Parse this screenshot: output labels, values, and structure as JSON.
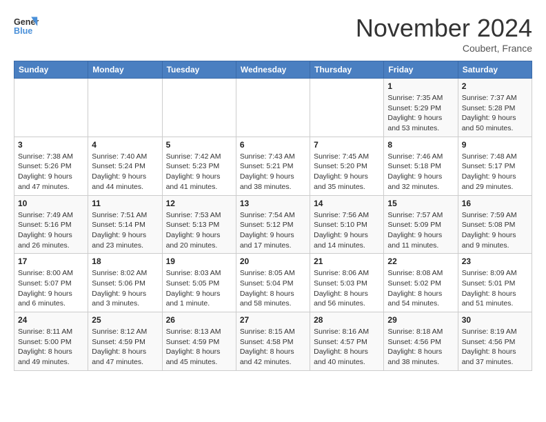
{
  "logo": {
    "line1": "General",
    "line2": "Blue"
  },
  "header": {
    "month": "November 2024",
    "location": "Coubert, France"
  },
  "weekdays": [
    "Sunday",
    "Monday",
    "Tuesday",
    "Wednesday",
    "Thursday",
    "Friday",
    "Saturday"
  ],
  "weeks": [
    [
      {
        "day": "",
        "info": ""
      },
      {
        "day": "",
        "info": ""
      },
      {
        "day": "",
        "info": ""
      },
      {
        "day": "",
        "info": ""
      },
      {
        "day": "",
        "info": ""
      },
      {
        "day": "1",
        "info": "Sunrise: 7:35 AM\nSunset: 5:29 PM\nDaylight: 9 hours\nand 53 minutes."
      },
      {
        "day": "2",
        "info": "Sunrise: 7:37 AM\nSunset: 5:28 PM\nDaylight: 9 hours\nand 50 minutes."
      }
    ],
    [
      {
        "day": "3",
        "info": "Sunrise: 7:38 AM\nSunset: 5:26 PM\nDaylight: 9 hours\nand 47 minutes."
      },
      {
        "day": "4",
        "info": "Sunrise: 7:40 AM\nSunset: 5:24 PM\nDaylight: 9 hours\nand 44 minutes."
      },
      {
        "day": "5",
        "info": "Sunrise: 7:42 AM\nSunset: 5:23 PM\nDaylight: 9 hours\nand 41 minutes."
      },
      {
        "day": "6",
        "info": "Sunrise: 7:43 AM\nSunset: 5:21 PM\nDaylight: 9 hours\nand 38 minutes."
      },
      {
        "day": "7",
        "info": "Sunrise: 7:45 AM\nSunset: 5:20 PM\nDaylight: 9 hours\nand 35 minutes."
      },
      {
        "day": "8",
        "info": "Sunrise: 7:46 AM\nSunset: 5:18 PM\nDaylight: 9 hours\nand 32 minutes."
      },
      {
        "day": "9",
        "info": "Sunrise: 7:48 AM\nSunset: 5:17 PM\nDaylight: 9 hours\nand 29 minutes."
      }
    ],
    [
      {
        "day": "10",
        "info": "Sunrise: 7:49 AM\nSunset: 5:16 PM\nDaylight: 9 hours\nand 26 minutes."
      },
      {
        "day": "11",
        "info": "Sunrise: 7:51 AM\nSunset: 5:14 PM\nDaylight: 9 hours\nand 23 minutes."
      },
      {
        "day": "12",
        "info": "Sunrise: 7:53 AM\nSunset: 5:13 PM\nDaylight: 9 hours\nand 20 minutes."
      },
      {
        "day": "13",
        "info": "Sunrise: 7:54 AM\nSunset: 5:12 PM\nDaylight: 9 hours\nand 17 minutes."
      },
      {
        "day": "14",
        "info": "Sunrise: 7:56 AM\nSunset: 5:10 PM\nDaylight: 9 hours\nand 14 minutes."
      },
      {
        "day": "15",
        "info": "Sunrise: 7:57 AM\nSunset: 5:09 PM\nDaylight: 9 hours\nand 11 minutes."
      },
      {
        "day": "16",
        "info": "Sunrise: 7:59 AM\nSunset: 5:08 PM\nDaylight: 9 hours\nand 9 minutes."
      }
    ],
    [
      {
        "day": "17",
        "info": "Sunrise: 8:00 AM\nSunset: 5:07 PM\nDaylight: 9 hours\nand 6 minutes."
      },
      {
        "day": "18",
        "info": "Sunrise: 8:02 AM\nSunset: 5:06 PM\nDaylight: 9 hours\nand 3 minutes."
      },
      {
        "day": "19",
        "info": "Sunrise: 8:03 AM\nSunset: 5:05 PM\nDaylight: 9 hours\nand 1 minute."
      },
      {
        "day": "20",
        "info": "Sunrise: 8:05 AM\nSunset: 5:04 PM\nDaylight: 8 hours\nand 58 minutes."
      },
      {
        "day": "21",
        "info": "Sunrise: 8:06 AM\nSunset: 5:03 PM\nDaylight: 8 hours\nand 56 minutes."
      },
      {
        "day": "22",
        "info": "Sunrise: 8:08 AM\nSunset: 5:02 PM\nDaylight: 8 hours\nand 54 minutes."
      },
      {
        "day": "23",
        "info": "Sunrise: 8:09 AM\nSunset: 5:01 PM\nDaylight: 8 hours\nand 51 minutes."
      }
    ],
    [
      {
        "day": "24",
        "info": "Sunrise: 8:11 AM\nSunset: 5:00 PM\nDaylight: 8 hours\nand 49 minutes."
      },
      {
        "day": "25",
        "info": "Sunrise: 8:12 AM\nSunset: 4:59 PM\nDaylight: 8 hours\nand 47 minutes."
      },
      {
        "day": "26",
        "info": "Sunrise: 8:13 AM\nSunset: 4:59 PM\nDaylight: 8 hours\nand 45 minutes."
      },
      {
        "day": "27",
        "info": "Sunrise: 8:15 AM\nSunset: 4:58 PM\nDaylight: 8 hours\nand 42 minutes."
      },
      {
        "day": "28",
        "info": "Sunrise: 8:16 AM\nSunset: 4:57 PM\nDaylight: 8 hours\nand 40 minutes."
      },
      {
        "day": "29",
        "info": "Sunrise: 8:18 AM\nSunset: 4:56 PM\nDaylight: 8 hours\nand 38 minutes."
      },
      {
        "day": "30",
        "info": "Sunrise: 8:19 AM\nSunset: 4:56 PM\nDaylight: 8 hours\nand 37 minutes."
      }
    ]
  ]
}
